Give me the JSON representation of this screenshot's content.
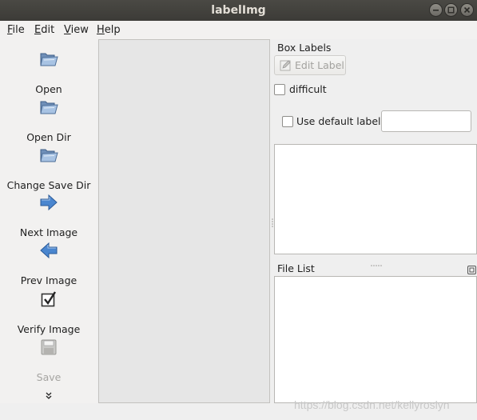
{
  "window": {
    "title": "labelImg"
  },
  "menu": {
    "items": [
      {
        "key": "F",
        "rest": "ile"
      },
      {
        "key": "E",
        "rest": "dit"
      },
      {
        "key": "V",
        "rest": "iew"
      },
      {
        "key": "H",
        "rest": "elp"
      }
    ]
  },
  "toolbar": {
    "open": {
      "label": "Open",
      "icon": "folder-open-icon"
    },
    "open_dir": {
      "label": "Open Dir",
      "icon": "folder-open-icon"
    },
    "change_save_dir": {
      "label": "Change Save Dir",
      "icon": "folder-open-icon"
    },
    "next_image": {
      "label": "Next Image",
      "icon": "arrow-right-icon"
    },
    "prev_image": {
      "label": "Prev Image",
      "icon": "arrow-left-icon"
    },
    "verify_image": {
      "label": "Verify Image",
      "icon": "checkbox-check-icon"
    },
    "save": {
      "label": "Save",
      "icon": "floppy-disk-icon",
      "disabled": true
    },
    "more": "»"
  },
  "dock": {
    "title": "Box Labels",
    "edit_label": "Edit Label",
    "difficult": "difficult",
    "use_default_label": "Use default label",
    "default_label_value": "",
    "file_list_title": "File List"
  },
  "watermark": "https://blog.csdn.net/kellyroslyn",
  "colors": {
    "titlebar": "#3c3b37",
    "arrow_blue": "#3b78c8",
    "folder": "#7fa4d4"
  }
}
